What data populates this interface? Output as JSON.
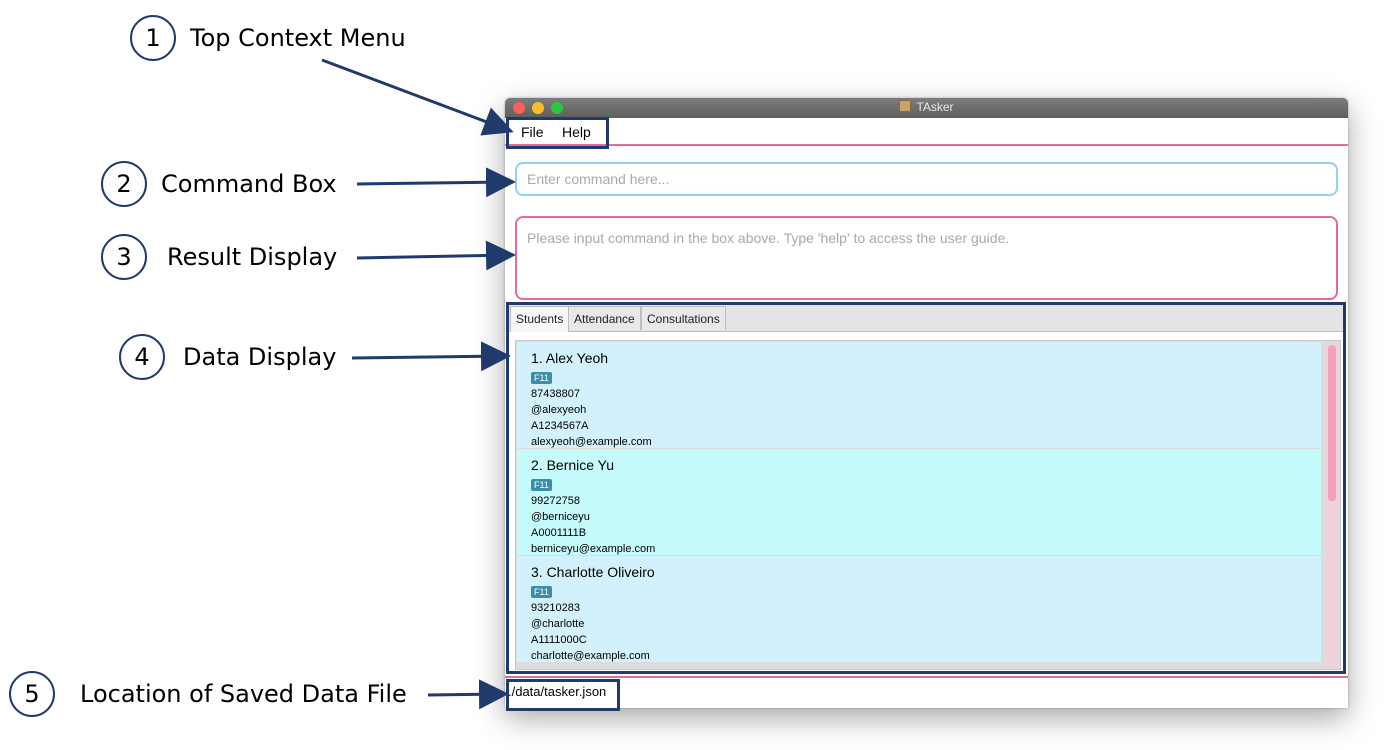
{
  "annotations": [
    {
      "num": "1",
      "label": "Top Context Menu"
    },
    {
      "num": "2",
      "label": "Command Box"
    },
    {
      "num": "3",
      "label": "Result Display"
    },
    {
      "num": "4",
      "label": "Data Display"
    },
    {
      "num": "5",
      "label": "Location of Saved Data File"
    }
  ],
  "window": {
    "title": "TAsker",
    "menu": {
      "file": "File",
      "help": "Help"
    },
    "command_placeholder": "Enter command here...",
    "result_text": "Please input command in the box above. Type 'help' to access the user guide.",
    "tabs": [
      "Students",
      "Attendance",
      "Consultations"
    ],
    "students": [
      {
        "name": "1.  Alex Yeoh",
        "tag": "F11",
        "phone": "87438807",
        "telegram": "@alexyeoh",
        "id": "A1234567A",
        "email": "alexyeoh@example.com"
      },
      {
        "name": "2.  Bernice Yu",
        "tag": "F11",
        "phone": "99272758",
        "telegram": "@berniceyu",
        "id": "A0001111B",
        "email": "berniceyu@example.com"
      },
      {
        "name": "3.  Charlotte Oliveiro",
        "tag": "F11",
        "phone": "93210283",
        "telegram": "@charlotte",
        "id": "A1111000C",
        "email": "charlotte@example.com"
      }
    ],
    "status_path": "./data/tasker.json"
  },
  "colors": {
    "annotation_blue": "#1f3a6b",
    "accent_pink": "#e36d9a",
    "command_border": "#8fd3f0"
  }
}
